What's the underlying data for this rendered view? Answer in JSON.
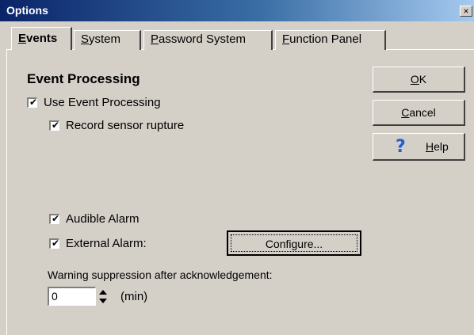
{
  "window": {
    "title": "Options",
    "close_glyph": "×"
  },
  "tabs": [
    {
      "label": "Events",
      "mnemonic": "E",
      "rest": "vents",
      "active": true
    },
    {
      "label": "System",
      "mnemonic": "S",
      "rest": "ystem",
      "active": false
    },
    {
      "label": "Password System",
      "mnemonic": "P",
      "rest": "assword System",
      "active": false
    },
    {
      "label": "Function Panel",
      "mnemonic": "F",
      "rest": "unction Panel",
      "active": false
    }
  ],
  "section": {
    "title": "Event Processing"
  },
  "checkboxes": {
    "use_event_processing": {
      "label": "Use Event Processing",
      "checked": true
    },
    "record_sensor_rupture": {
      "label": "Record sensor rupture",
      "checked": true
    },
    "audible_alarm": {
      "label": "Audible Alarm",
      "checked": true
    },
    "external_alarm": {
      "label": "External Alarm:",
      "checked": true
    }
  },
  "buttons": {
    "ok": {
      "mnemonic": "O",
      "rest": "K"
    },
    "cancel": {
      "mnemonic": "C",
      "rest": "ancel"
    },
    "help": {
      "mnemonic": "H",
      "rest": "elp",
      "icon": "question-mark-icon"
    },
    "configure": {
      "label": "Configure..."
    }
  },
  "warning": {
    "label": "Warning suppression after acknowledgement:",
    "value": "0",
    "unit": "(min)"
  },
  "check_glyph": "✔",
  "colors": {
    "help_icon": "#1e5fd8",
    "titlebar_start": "#0a246a"
  }
}
